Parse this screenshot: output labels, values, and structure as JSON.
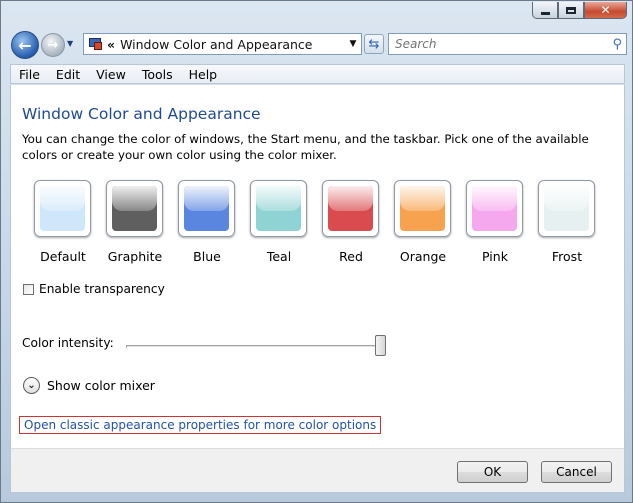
{
  "window": {
    "caption_buttons": {
      "minimize": "minimize-icon",
      "maximize": "maximize-icon",
      "close": "close-icon"
    }
  },
  "nav": {
    "back_icon": "back-arrow-icon",
    "forward_icon": "forward-arrow-icon",
    "address_prefix": "«",
    "address_text": "Window Color and Appearance",
    "refresh_icon": "refresh-icon",
    "search_placeholder": "Search",
    "search_icon": "search-icon"
  },
  "menu": [
    "File",
    "Edit",
    "View",
    "Tools",
    "Help"
  ],
  "main": {
    "title": "Window Color and Appearance",
    "description": "You can change the color of windows, the Start menu, and the taskbar. Pick one of the available colors or create your own color using the color mixer.",
    "swatches": [
      {
        "label": "Default",
        "color": "#cfe6fb"
      },
      {
        "label": "Graphite",
        "color": "#5f5f5f"
      },
      {
        "label": "Blue",
        "color": "#5a86e0"
      },
      {
        "label": "Teal",
        "color": "#8fd3d4"
      },
      {
        "label": "Red",
        "color": "#d94b4f"
      },
      {
        "label": "Orange",
        "color": "#f7a24e"
      },
      {
        "label": "Pink",
        "color": "#f6a8ee"
      },
      {
        "label": "Frost",
        "color": "#e6f0f0"
      }
    ],
    "transparency_label": "Enable transparency",
    "transparency_checked": false,
    "intensity_label": "Color intensity:",
    "intensity_value": 1.0,
    "mixer_label": "Show color mixer",
    "classic_link": "Open classic appearance properties for more color options"
  },
  "footer": {
    "ok": "OK",
    "cancel": "Cancel"
  }
}
